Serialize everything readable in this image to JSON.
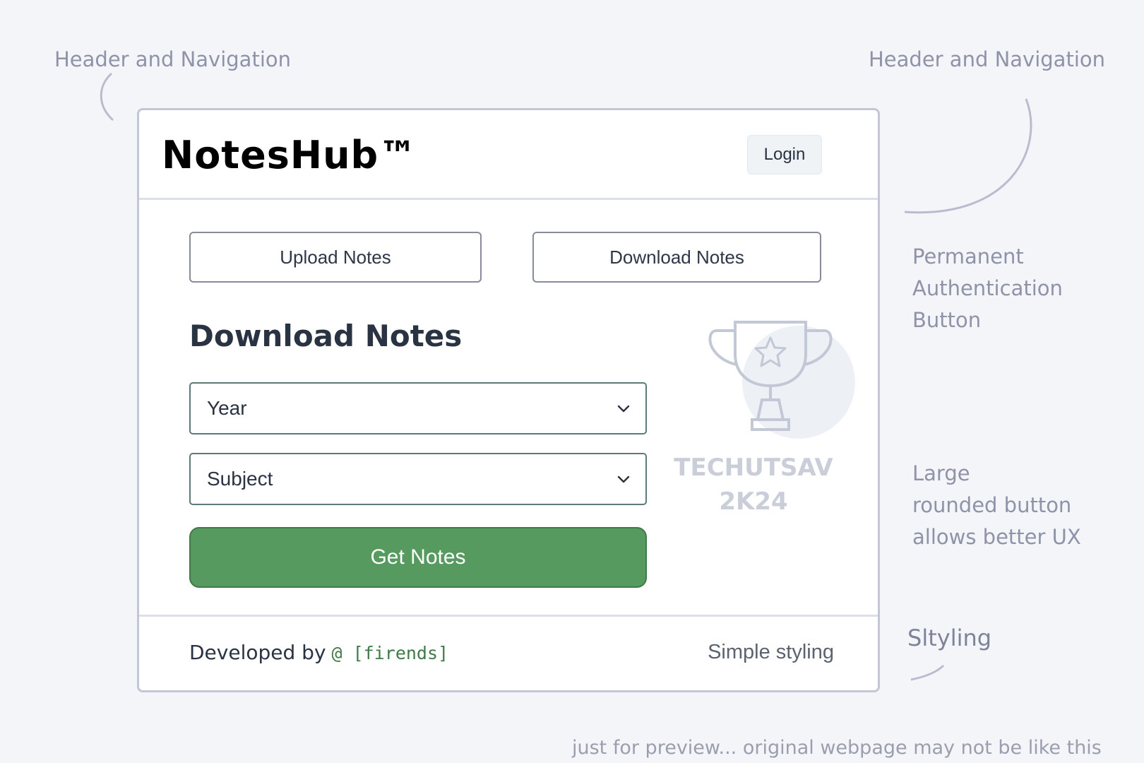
{
  "annotations": {
    "header_nav_left": "Header and Navigation",
    "header_nav_right": "Header and Navigation",
    "permanent_auth": [
      "Permanent",
      "Authentication",
      "Button"
    ],
    "large_button": [
      "Large",
      "rounded button",
      "allows better UX"
    ],
    "styling": "Sltyling",
    "preview_note": "just for preview... original webpage may not be like this"
  },
  "header": {
    "brand": "NotesHub™",
    "login_label": "Login"
  },
  "tabs": {
    "upload_label": "Upload Notes",
    "download_label": "Download Notes"
  },
  "main": {
    "section_title": "Download Notes",
    "year_select": {
      "selected": "Year"
    },
    "subject_select": {
      "selected": "Subject"
    },
    "get_notes_label": "Get Notes"
  },
  "event_logo": {
    "line1": "TECHUTSAV",
    "line2": "2K24",
    "icon": "trophy-icon"
  },
  "footer": {
    "developed_by": "Developed by",
    "handle": "@ [firends]",
    "simple_styling": "Simple styling"
  },
  "colors": {
    "primary_green": "#579a5f",
    "background": "#f4f5f9",
    "annotation_text": "#8e93a8"
  }
}
